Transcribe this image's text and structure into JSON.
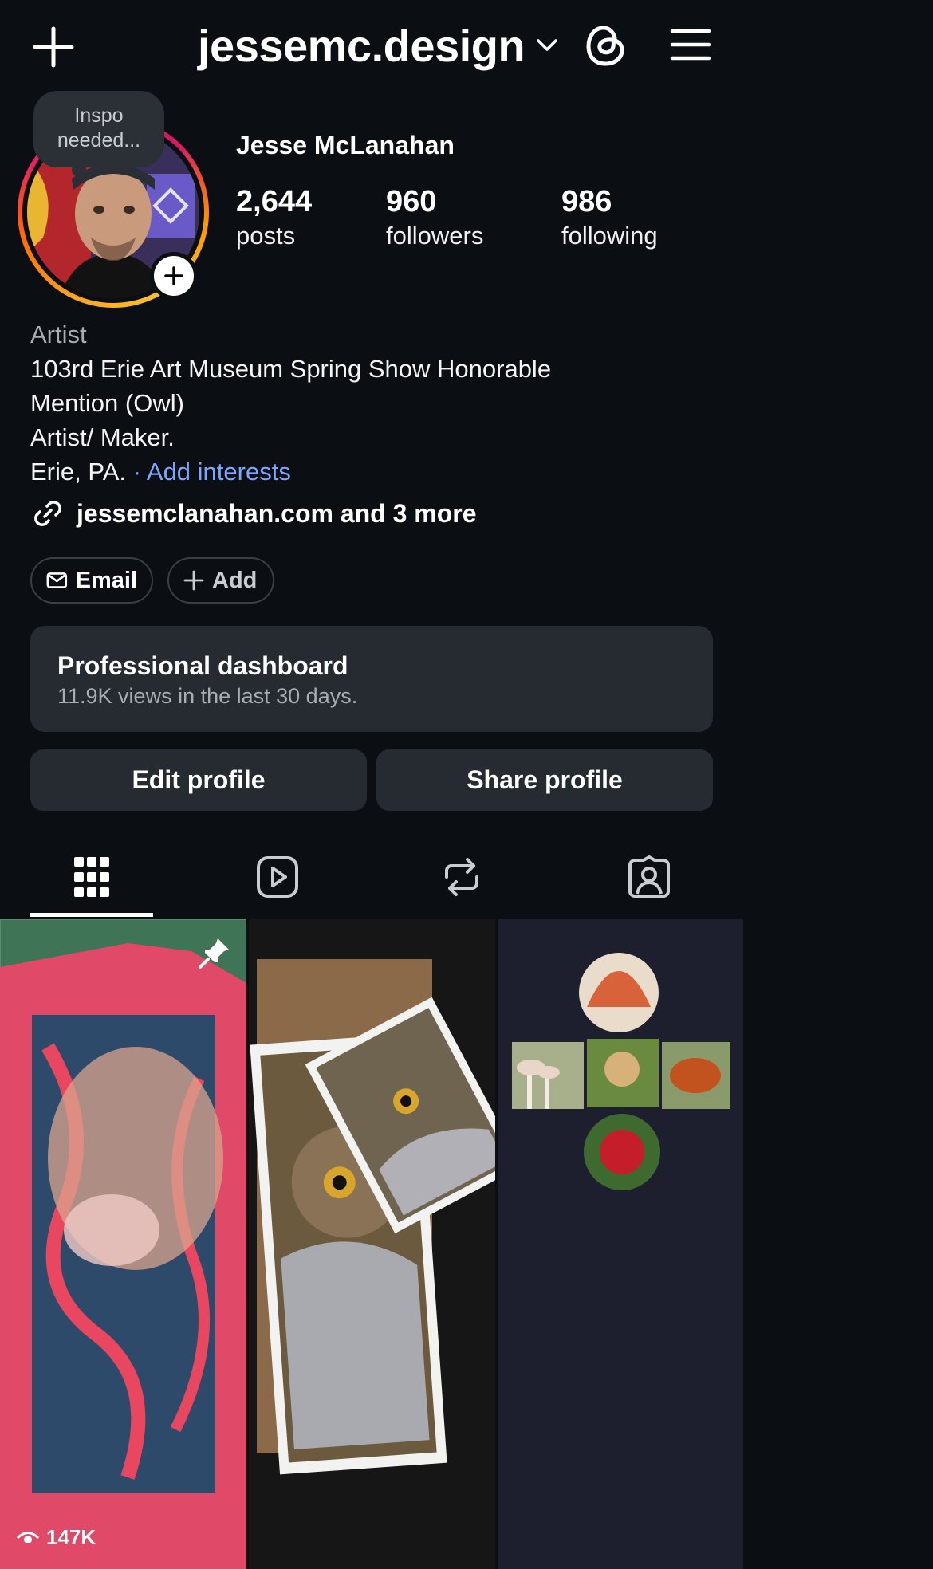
{
  "header": {
    "username": "jessemc.design"
  },
  "note": {
    "text_line1": "Inspo",
    "text_line2": "needed..."
  },
  "profile": {
    "display_name": "Jesse McLanahan",
    "stats": [
      {
        "value": "2,644",
        "label": "posts"
      },
      {
        "value": "960",
        "label": "followers"
      },
      {
        "value": "986",
        "label": "following"
      }
    ]
  },
  "bio": {
    "category": "Artist",
    "line1": "103rd Erie Art Museum Spring Show Honorable",
    "line2": "Mention (Owl)",
    "line3": "Artist/ Maker.",
    "location": "Erie, PA.",
    "separator": "·",
    "interests_link": "Add interests",
    "link_text": "jessemclanahan.com and 3 more"
  },
  "contact": {
    "email_label": "Email",
    "add_label": "Add"
  },
  "dashboard": {
    "title": "Professional dashboard",
    "subtitle": "11.9K views in the last 30 days."
  },
  "actions": {
    "edit_label": "Edit profile",
    "share_label": "Share profile"
  },
  "tabs": [
    "grid-icon",
    "reels-icon",
    "reposts-icon",
    "tagged-icon"
  ],
  "posts": [
    {
      "views": "147K",
      "pinned": true,
      "subject": "pink octopus frame"
    },
    {
      "subject": "owl prints"
    },
    {
      "subject": "mini paintings: shell, mushrooms, snail, acorn, rose"
    }
  ],
  "colors": {
    "background": "#0b0f14",
    "surface": "#262b31",
    "link_blue": "#7fa6ff",
    "muted_text": "#a8adb3"
  }
}
